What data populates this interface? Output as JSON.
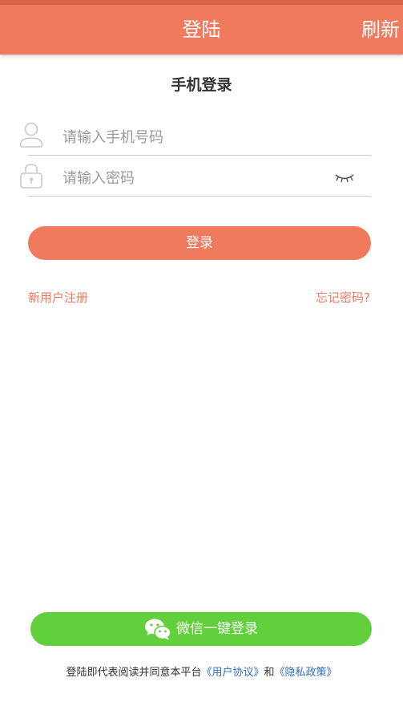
{
  "header": {
    "title": "登陆",
    "refresh_label": "刷新"
  },
  "login": {
    "section_title": "手机登录",
    "phone_placeholder": "请输入手机号码",
    "password_placeholder": "请输入密码",
    "submit_label": "登录"
  },
  "links": {
    "register": "新用户注册",
    "forgot_password": "忘记密码?"
  },
  "wechat": {
    "label": "微信一键登录"
  },
  "agreement": {
    "prefix": "登陆即代表阅读并同意本平台",
    "user_agreement": "《用户协议》",
    "conjunction": "和",
    "privacy_policy": "《隐私政策》"
  },
  "icons": {
    "phone_field": "user-icon",
    "password_field": "lock-icon",
    "password_toggle": "eye-closed-icon",
    "wechat": "wechat-icon"
  },
  "colors": {
    "accent": "#f07a5e",
    "wechat_green": "#62cf3c",
    "link_blue": "#2f6fc0"
  }
}
